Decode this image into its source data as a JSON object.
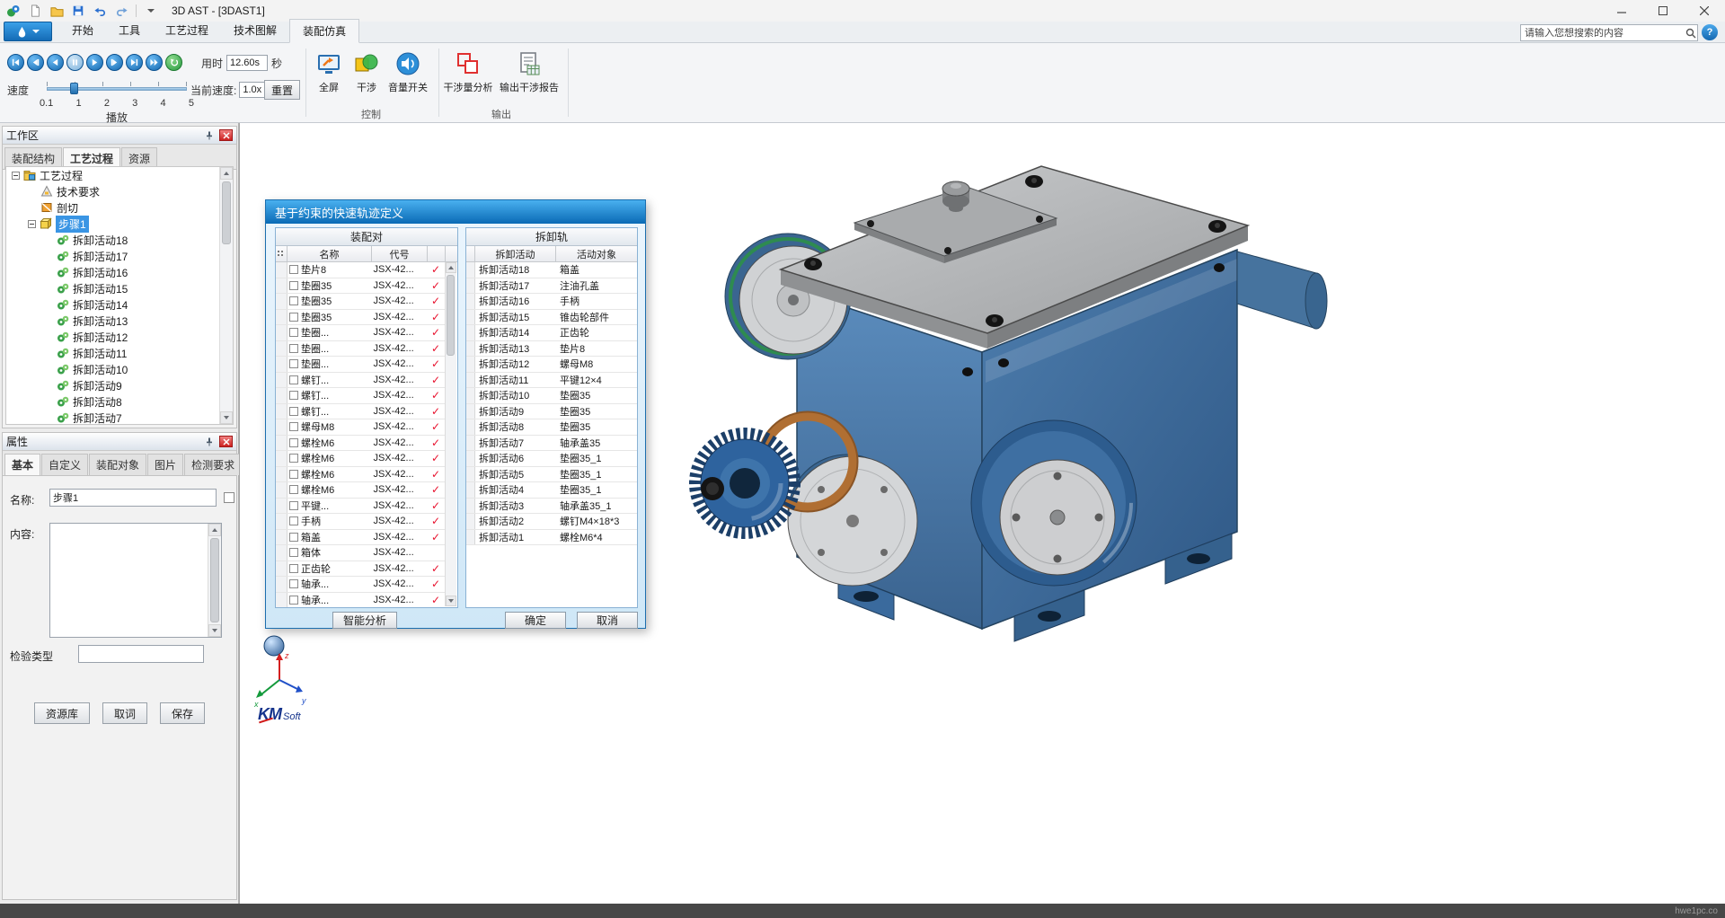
{
  "window": {
    "title": "3D AST - [3DAST1]",
    "watermark": "hwe1pc.co"
  },
  "ribbon": {
    "tabs": [
      {
        "label": "开始"
      },
      {
        "label": "工具"
      },
      {
        "label": "工艺过程"
      },
      {
        "label": "技术图解"
      },
      {
        "label": "装配仿真",
        "active": true
      }
    ],
    "search_placeholder": "请输入您想搜索的内容",
    "help_glyph": "?",
    "playback": {
      "elapsed_label": "用时",
      "elapsed_value": "12.60s",
      "elapsed_unit": "秒",
      "speed_label": "速度",
      "ticks": [
        "0.1",
        "1",
        "2",
        "3",
        "4",
        "5"
      ],
      "play_label": "播放",
      "current_speed_label": "当前速度:",
      "current_speed_value": "1.0x",
      "reset_label": "重置"
    },
    "control_group": {
      "label": "控制",
      "buttons": [
        {
          "label": "全屏"
        },
        {
          "label": "干涉"
        },
        {
          "label": "音量开关"
        }
      ]
    },
    "output_group": {
      "label": "输出",
      "buttons": [
        {
          "label": "干涉量分析"
        },
        {
          "label": "输出干涉报告"
        }
      ]
    }
  },
  "workspace": {
    "title": "工作区",
    "tabs": [
      {
        "label": "装配结构"
      },
      {
        "label": "工艺过程",
        "active": true
      },
      {
        "label": "资源"
      }
    ],
    "tree_root": "工艺过程",
    "tree_items": [
      "技术要求",
      "剖切"
    ],
    "selected_step": "步骤1",
    "activities": [
      "拆卸活动18",
      "拆卸活动17",
      "拆卸活动16",
      "拆卸活动15",
      "拆卸活动14",
      "拆卸活动13",
      "拆卸活动12",
      "拆卸活动11",
      "拆卸活动10",
      "拆卸活动9",
      "拆卸活动8",
      "拆卸活动7"
    ]
  },
  "properties": {
    "title": "属性",
    "tabs": [
      {
        "label": "基本",
        "active": true
      },
      {
        "label": "自定义"
      },
      {
        "label": "装配对象"
      },
      {
        "label": "图片"
      },
      {
        "label": "检测要求"
      }
    ],
    "name_label": "名称:",
    "name_value": "步骤1",
    "content_label": "内容:",
    "check_type_label": "检验类型",
    "check_type_value": "",
    "buttons": [
      "资源库",
      "取词",
      "保存"
    ]
  },
  "dialog": {
    "title": "基于约束的快速轨迹定义",
    "left_panel": {
      "title": "装配对",
      "columns": [
        "名称",
        "代号"
      ],
      "rows": [
        {
          "name": "垫片8",
          "code": "JSX-42...",
          "mark": "✓"
        },
        {
          "name": "垫圈35",
          "code": "JSX-42...",
          "mark": "✓"
        },
        {
          "name": "垫圈35",
          "code": "JSX-42...",
          "mark": "✓"
        },
        {
          "name": "垫圈35",
          "code": "JSX-42...",
          "mark": "✓"
        },
        {
          "name": "垫圈...",
          "code": "JSX-42...",
          "mark": "✓"
        },
        {
          "name": "垫圈...",
          "code": "JSX-42...",
          "mark": "✓"
        },
        {
          "name": "垫圈...",
          "code": "JSX-42...",
          "mark": "✓"
        },
        {
          "name": "螺钉...",
          "code": "JSX-42...",
          "mark": "✓"
        },
        {
          "name": "螺钉...",
          "code": "JSX-42...",
          "mark": "✓"
        },
        {
          "name": "螺钉...",
          "code": "JSX-42...",
          "mark": "✓"
        },
        {
          "name": "螺母M8",
          "code": "JSX-42...",
          "mark": "✓"
        },
        {
          "name": "螺栓M6",
          "code": "JSX-42...",
          "mark": "✓"
        },
        {
          "name": "螺栓M6",
          "code": "JSX-42...",
          "mark": "✓"
        },
        {
          "name": "螺栓M6",
          "code": "JSX-42...",
          "mark": "✓"
        },
        {
          "name": "螺栓M6",
          "code": "JSX-42...",
          "mark": "✓"
        },
        {
          "name": "平键...",
          "code": "JSX-42...",
          "mark": "✓"
        },
        {
          "name": "手柄",
          "code": "JSX-42...",
          "mark": "✓"
        },
        {
          "name": "箱盖",
          "code": "JSX-42...",
          "mark": "✓"
        },
        {
          "name": "箱体",
          "code": "JSX-42...",
          "mark": ""
        },
        {
          "name": "正齿轮",
          "code": "JSX-42...",
          "mark": "✓"
        },
        {
          "name": "轴承...",
          "code": "JSX-42...",
          "mark": "✓"
        },
        {
          "name": "轴承...",
          "code": "JSX-42...",
          "mark": "✓"
        }
      ]
    },
    "right_panel": {
      "title": "拆卸轨",
      "columns": [
        "拆卸活动",
        "活动对象"
      ],
      "rows": [
        {
          "activity": "拆卸活动18",
          "object": "箱盖"
        },
        {
          "activity": "拆卸活动17",
          "object": "注油孔盖"
        },
        {
          "activity": "拆卸活动16",
          "object": "手柄"
        },
        {
          "activity": "拆卸活动15",
          "object": "锥齿轮部件"
        },
        {
          "activity": "拆卸活动14",
          "object": "正齿轮"
        },
        {
          "activity": "拆卸活动13",
          "object": "垫片8"
        },
        {
          "activity": "拆卸活动12",
          "object": "螺母M8"
        },
        {
          "activity": "拆卸活动11",
          "object": "平键12×4"
        },
        {
          "activity": "拆卸活动10",
          "object": "垫圈35"
        },
        {
          "activity": "拆卸活动9",
          "object": "垫圈35"
        },
        {
          "activity": "拆卸活动8",
          "object": "垫圈35"
        },
        {
          "activity": "拆卸活动7",
          "object": "轴承盖35"
        },
        {
          "activity": "拆卸活动6",
          "object": "垫圈35_1"
        },
        {
          "activity": "拆卸活动5",
          "object": "垫圈35_1"
        },
        {
          "activity": "拆卸活动4",
          "object": "垫圈35_1"
        },
        {
          "activity": "拆卸活动3",
          "object": "轴承盖35_1"
        },
        {
          "activity": "拆卸活动2",
          "object": "螺钉M4×18*3"
        },
        {
          "activity": "拆卸活动1",
          "object": "螺栓M6*4"
        }
      ]
    },
    "analyze_label": "智能分析",
    "ok_label": "确定",
    "cancel_label": "取消"
  },
  "viewport": {
    "logo_km": "KM",
    "logo_soft": "Soft",
    "axis_labels": {
      "x": "x",
      "y": "y",
      "z": "z"
    }
  }
}
